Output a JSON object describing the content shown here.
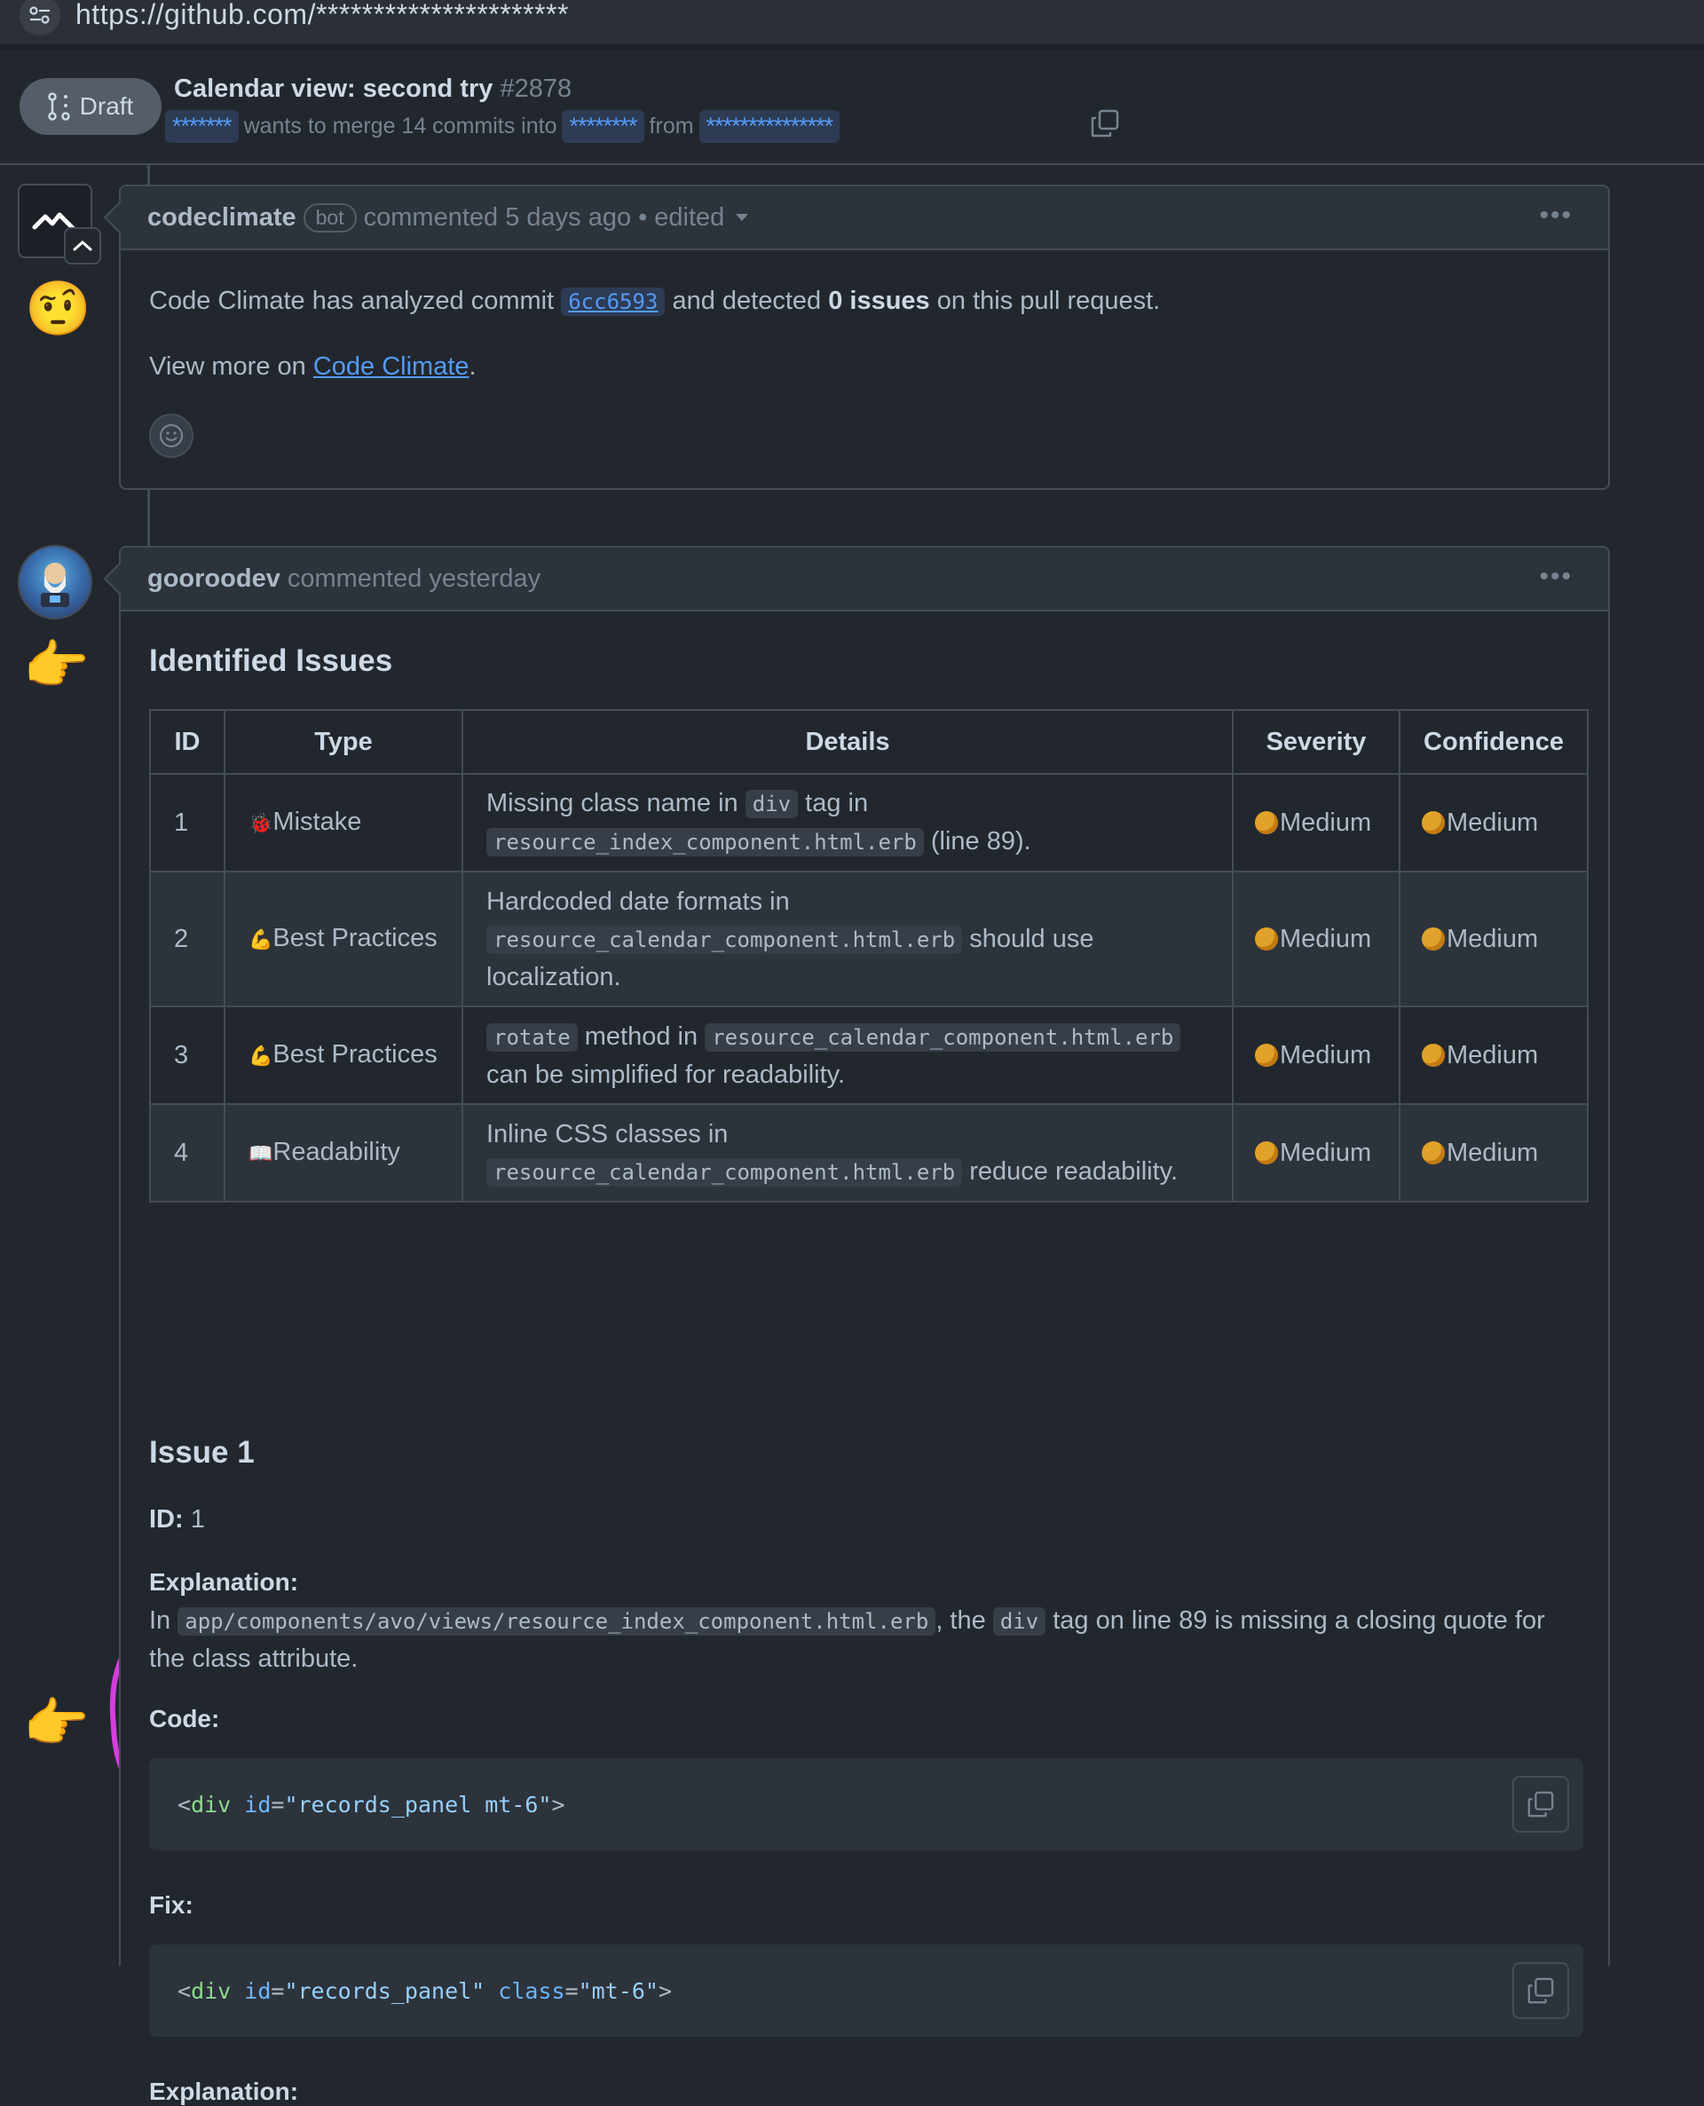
{
  "browser": {
    "url": "https://github.com/**********************"
  },
  "pr": {
    "draft_label": "Draft",
    "title": "Calendar view: second try",
    "number": "#2878",
    "author": "*******",
    "merge_text": "wants to merge 14 commits into",
    "base_branch": "********",
    "from_text": "from",
    "head_branch": "***************"
  },
  "comment1": {
    "author": "codeclimate",
    "badge": "bot",
    "meta": "commented 5 days ago",
    "edited": "edited",
    "body_prefix": "Code Climate has analyzed commit",
    "commit_sha": "6cc6593",
    "body_mid": "and detected",
    "issues_count": "0 issues",
    "body_suffix": "on this pull request.",
    "view_more_prefix": "View more on",
    "view_more_link": "Code Climate",
    "view_more_suffix": "."
  },
  "comment2": {
    "author": "gooroodev",
    "meta": "commented yesterday",
    "heading": "Identified Issues",
    "table": {
      "headers": [
        "ID",
        "Type",
        "Details",
        "Severity",
        "Confidence"
      ],
      "rows": [
        {
          "id": "1",
          "type_icon": "🐞",
          "type": "Mistake",
          "details": [
            {
              "t": "text",
              "v": "Missing class name in "
            },
            {
              "t": "code",
              "v": "div"
            },
            {
              "t": "text",
              "v": " tag in "
            },
            {
              "t": "code",
              "v": "resource_index_component.html.erb"
            },
            {
              "t": "text",
              "v": " (line 89)."
            }
          ],
          "severity": "Medium",
          "confidence": "Medium"
        },
        {
          "id": "2",
          "type_icon": "💪",
          "type": "Best Practices",
          "details": [
            {
              "t": "text",
              "v": "Hardcoded date formats in "
            },
            {
              "t": "code",
              "v": "resource_calendar_component.html.erb"
            },
            {
              "t": "text",
              "v": " should use localization."
            }
          ],
          "severity": "Medium",
          "confidence": "Medium"
        },
        {
          "id": "3",
          "type_icon": "💪",
          "type": "Best Practices",
          "details": [
            {
              "t": "code",
              "v": "rotate"
            },
            {
              "t": "text",
              "v": " method in "
            },
            {
              "t": "code",
              "v": "resource_calendar_component.html.erb"
            },
            {
              "t": "text",
              "v": " can be simplified for readability."
            }
          ],
          "severity": "Medium",
          "confidence": "Medium"
        },
        {
          "id": "4",
          "type_icon": "📖",
          "type": "Readability",
          "details": [
            {
              "t": "text",
              "v": "Inline CSS classes in "
            },
            {
              "t": "code",
              "v": "resource_calendar_component.html.erb"
            },
            {
              "t": "text",
              "v": " reduce readability."
            }
          ],
          "severity": "Medium",
          "confidence": "Medium"
        }
      ]
    },
    "issue1": {
      "heading": "Issue 1",
      "id_label": "ID:",
      "id_value": "1",
      "explanation_label": "Explanation:",
      "explanation_prefix": "In",
      "explanation_path": "app/components/avo/views/resource_index_component.html.erb",
      "explanation_mid": ", the",
      "explanation_tag": "div",
      "explanation_suffix": "tag on line 89 is missing a closing quote for the class attribute.",
      "code_label": "Code:",
      "code": {
        "tag_open": "<",
        "tag": "div",
        "attr": "id",
        "eq": "=",
        "value": "\"records_panel mt-6\"",
        "close": ">"
      },
      "fix_label": "Fix:",
      "fix": {
        "tag_open": "<",
        "tag": "div",
        "attr1": "id",
        "value1": "\"records_panel\"",
        "attr2": "class",
        "value2": "\"mt-6\"",
        "close": ">"
      },
      "explanation2_label": "Explanation:"
    }
  },
  "colors": {
    "background": "#22272e",
    "header_bg": "#2d333b",
    "border": "#444c56",
    "link": "#539bf5",
    "annotation_arrow": "#d63ee0"
  },
  "icons": [
    "settings-sliders-icon",
    "git-pr-draft-icon",
    "copy-icon",
    "kebab-menu-icon",
    "smiley-icon",
    "triangle-down-icon",
    "codeclimate-logo",
    "avatar-gooroodev",
    "face-raised-eyebrow-emoji",
    "pointing-hand-emoji"
  ]
}
